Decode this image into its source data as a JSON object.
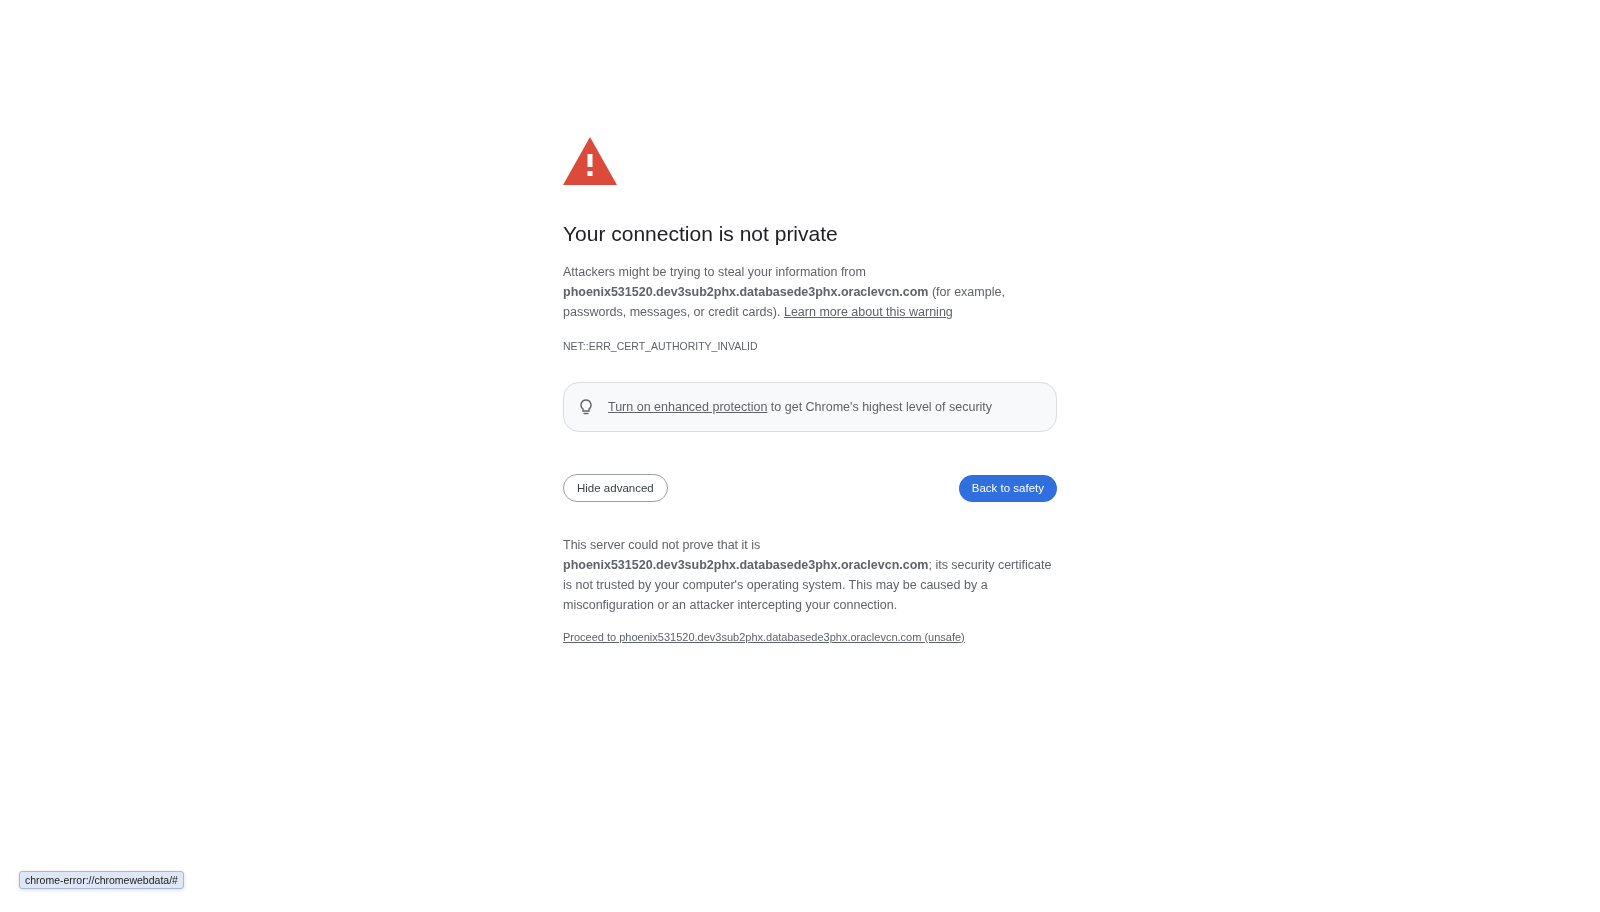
{
  "heading": "Your connection is not private",
  "intro": {
    "text": "Attackers might be trying to steal your information from **phoenix531520.dev3sub2phx.databasede3phx.oraclevcn.com** (for example, passwords, messages, or credit cards).",
    "link": "Learn more about this warning"
  },
  "error_code": "NET::ERR_CERT_AUTHORITY_INVALID",
  "tip": {
    "link": "Turn on enhanced protection",
    "text": "to get Chrome's highest level of security"
  },
  "buttons": [
    {
      "label": "Hide advanced",
      "kind": "secondary"
    },
    {
      "label": "Back to safety",
      "kind": "primary"
    }
  ],
  "details": "This server could not prove that it is **phoenix531520.dev3sub2phx.databasede3phx.oraclevcn.com**; its security certificate is not trusted by your computer's operating system. This may be caused by a misconfiguration or an attacker intercepting your connection.",
  "proceed_link": "Proceed to phoenix531520.dev3sub2phx.databasede3phx.oraclevcn.com (unsafe)",
  "status_url": "chrome-error://chromewebdata/#"
}
